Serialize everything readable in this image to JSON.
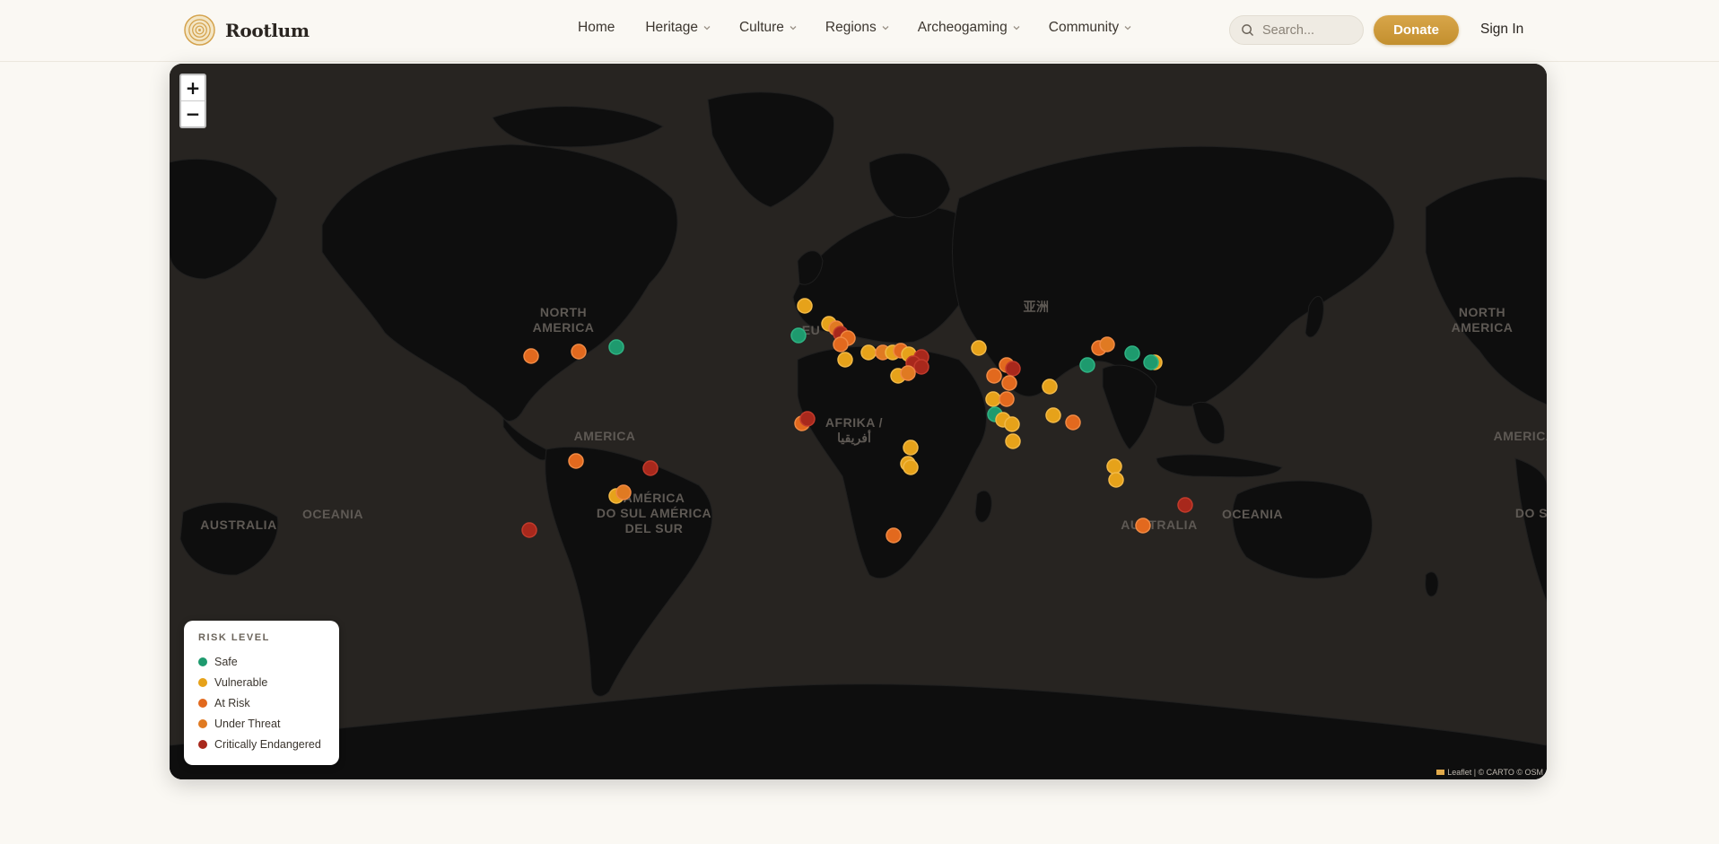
{
  "brand": {
    "name": "Rootlum"
  },
  "nav": {
    "home": "Home",
    "heritage": "Heritage",
    "culture": "Culture",
    "regions": "Regions",
    "archeogaming": "Archeogaming",
    "community": "Community"
  },
  "search": {
    "placeholder": "Search..."
  },
  "actions": {
    "donate": "Donate",
    "signin": "Sign In"
  },
  "map": {
    "zoom_in": "+",
    "zoom_out": "−",
    "attribution": "Leaflet | © CARTO © OSM",
    "labels": {
      "north_america": [
        "NORTH",
        "AMERICA"
      ],
      "north_america_right": [
        "NORTH",
        "AMERICA"
      ],
      "america": "AMERICA",
      "america_right": "AMERICA",
      "south_america": [
        "AMÉRICA",
        "DO SUL AMÉRICA",
        "DEL SUR"
      ],
      "do_sul_right": "DO S",
      "africa": [
        "AFRIKA /",
        "أفريقيا"
      ],
      "asia": "亚洲",
      "europe": "EU",
      "australia_left": "AUSTRALIA",
      "oceania_left": "OCEANIA",
      "australia": "AUSTRALIA",
      "oceania": "OCEANIA"
    },
    "colors": {
      "Safe": "#1e9a6e",
      "Vulnerable": "#e6a21a",
      "At Risk": "#e2691e",
      "Under Threat": "#e07a22",
      "Critically Endangered": "#a8281c"
    }
  },
  "legend": {
    "title": "RISK LEVEL",
    "items": [
      {
        "label": "Safe",
        "color": "#1e9a6e"
      },
      {
        "label": "Vulnerable",
        "color": "#e6a21a"
      },
      {
        "label": "At Risk",
        "color": "#e2691e"
      },
      {
        "label": "Under Threat",
        "color": "#e07a22"
      },
      {
        "label": "Critically Endangered",
        "color": "#a8281c"
      }
    ]
  }
}
